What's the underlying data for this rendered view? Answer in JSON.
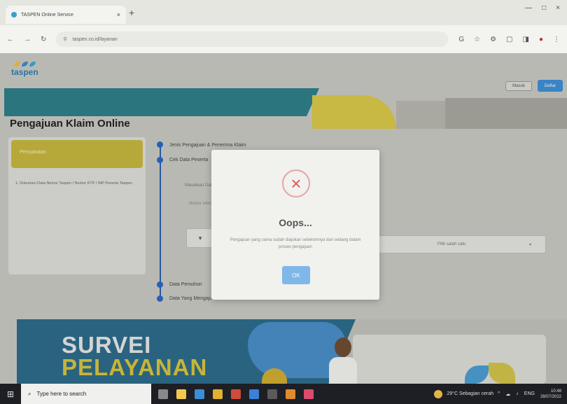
{
  "browser": {
    "tab_title": "TASPEN Online Service",
    "tab_close": "×",
    "new_tab": "+",
    "window_buttons": [
      "—",
      "□",
      "×"
    ],
    "nav": {
      "back": "←",
      "forward": "→",
      "reload": "↻"
    },
    "url": "taspen.co.id/layanan",
    "toolbar_icons": [
      "G",
      "☆",
      "⚙",
      "▢",
      "◨",
      "●",
      "⋮"
    ]
  },
  "header": {
    "logo_text": "taspen",
    "logo_colors": [
      "#f2c037",
      "#3a8fd0",
      "#39a9d6"
    ],
    "masuk": "Masuk",
    "daftar": "Daftar"
  },
  "page_title": "Pengajuan Klaim Online",
  "left_card": {
    "title": "Persyaratan",
    "body": "1. Dokumen Data Nomor Taspen / Nomor KTP / NIP Peserta Taspen."
  },
  "steps": [
    "Jenis Pengajuan & Penerima Klaim",
    "Cek Data Peserta",
    "Data Pemohon",
    "Data Yang Mengajukan Klaim"
  ],
  "form": {
    "label1": "Masukkan Data Peserta",
    "label2": "Nomor Identitas",
    "box_a": "▾",
    "select_placeholder": "Pilih salah satu",
    "select_arrow": "▾"
  },
  "modal": {
    "icon": "×",
    "title": "Oops...",
    "message": "Pengajuan yang sama sudah diajukan sebelumnya dan sedang dalam proses pengajuan",
    "ok": "OK"
  },
  "survey": {
    "line1": "SURVEI",
    "line2": "PELAYANAN"
  },
  "taskbar": {
    "start_icon": "⊞",
    "search_icon": "⌕",
    "search_placeholder": "Type here to search",
    "app_colors": [
      "#888888",
      "#f2c94c",
      "#3a8ed6",
      "#e0b030",
      "#d04b3b",
      "#3b7fd8",
      "#5a5a5a",
      "#e08a2c",
      "#d94c6b"
    ],
    "weather": "29°C Sebagian cerah",
    "tray": [
      "^",
      "☁",
      "♪",
      "ENG"
    ],
    "clock_time": "10:48",
    "clock_date": "28/07/2022"
  }
}
